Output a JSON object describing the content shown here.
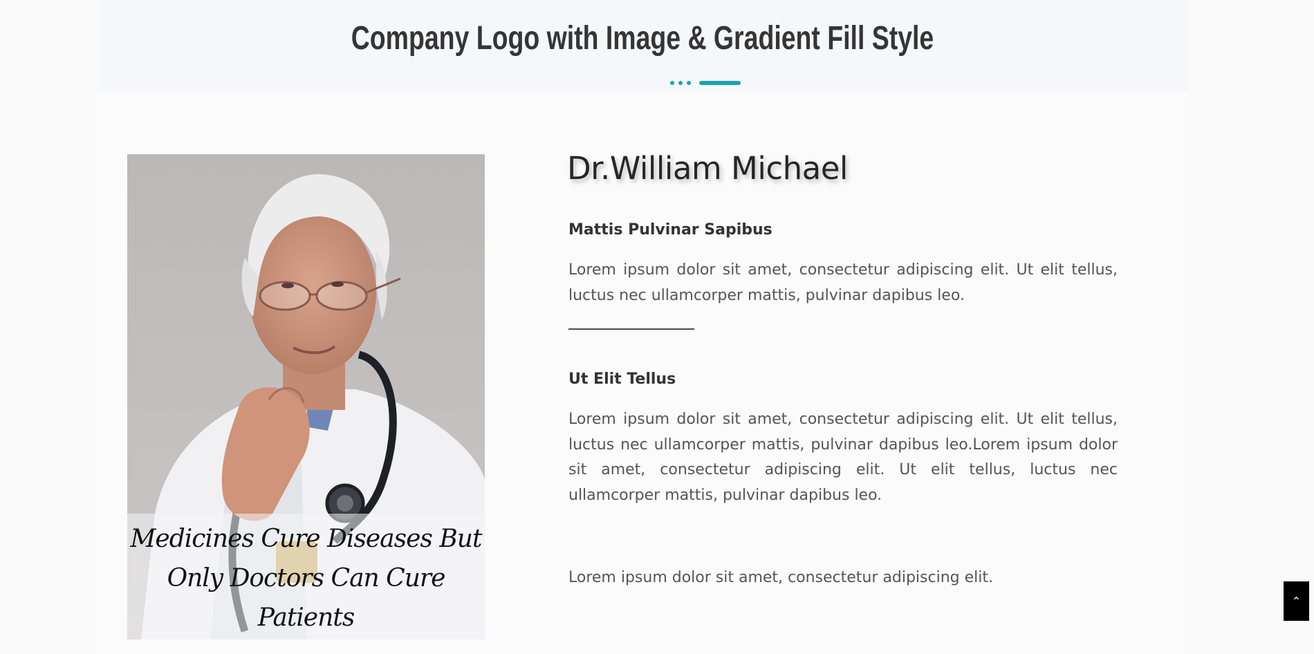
{
  "section": {
    "title": "Company Logo with Image & Gradient Fill Style"
  },
  "photo": {
    "caption": "Medicines Cure Diseases But Only Doctors Can Cure Patients"
  },
  "profile": {
    "name": "Dr.William Michael",
    "heading_1": "Mattis Pulvinar Sapibus",
    "paragraph_1": "Lorem ipsum dolor sit amet, consectetur adipiscing elit. Ut elit tellus, luctus nec ullamcorper mattis, pulvinar dapibus leo.",
    "heading_2": "Ut Elit Tellus",
    "paragraph_2": "Lorem ipsum dolor sit amet, consectetur adipiscing elit. Ut elit tellus, luctus nec ullamcorper mattis, pulvinar dapibus leo.Lorem ipsum dolor sit amet, consectetur adipiscing elit. Ut elit tellus, luctus nec ullamcorper mattis, pulvinar dapibus leo.",
    "paragraph_3": "Lorem ipsum dolor sit amet, consectetur adipiscing elit."
  },
  "back_to_top": {
    "icon": "chevron-up-icon",
    "glyph": "⌃"
  },
  "colors": {
    "accent": "#1aa3b3",
    "title": "#353535",
    "body_text": "#555555"
  }
}
